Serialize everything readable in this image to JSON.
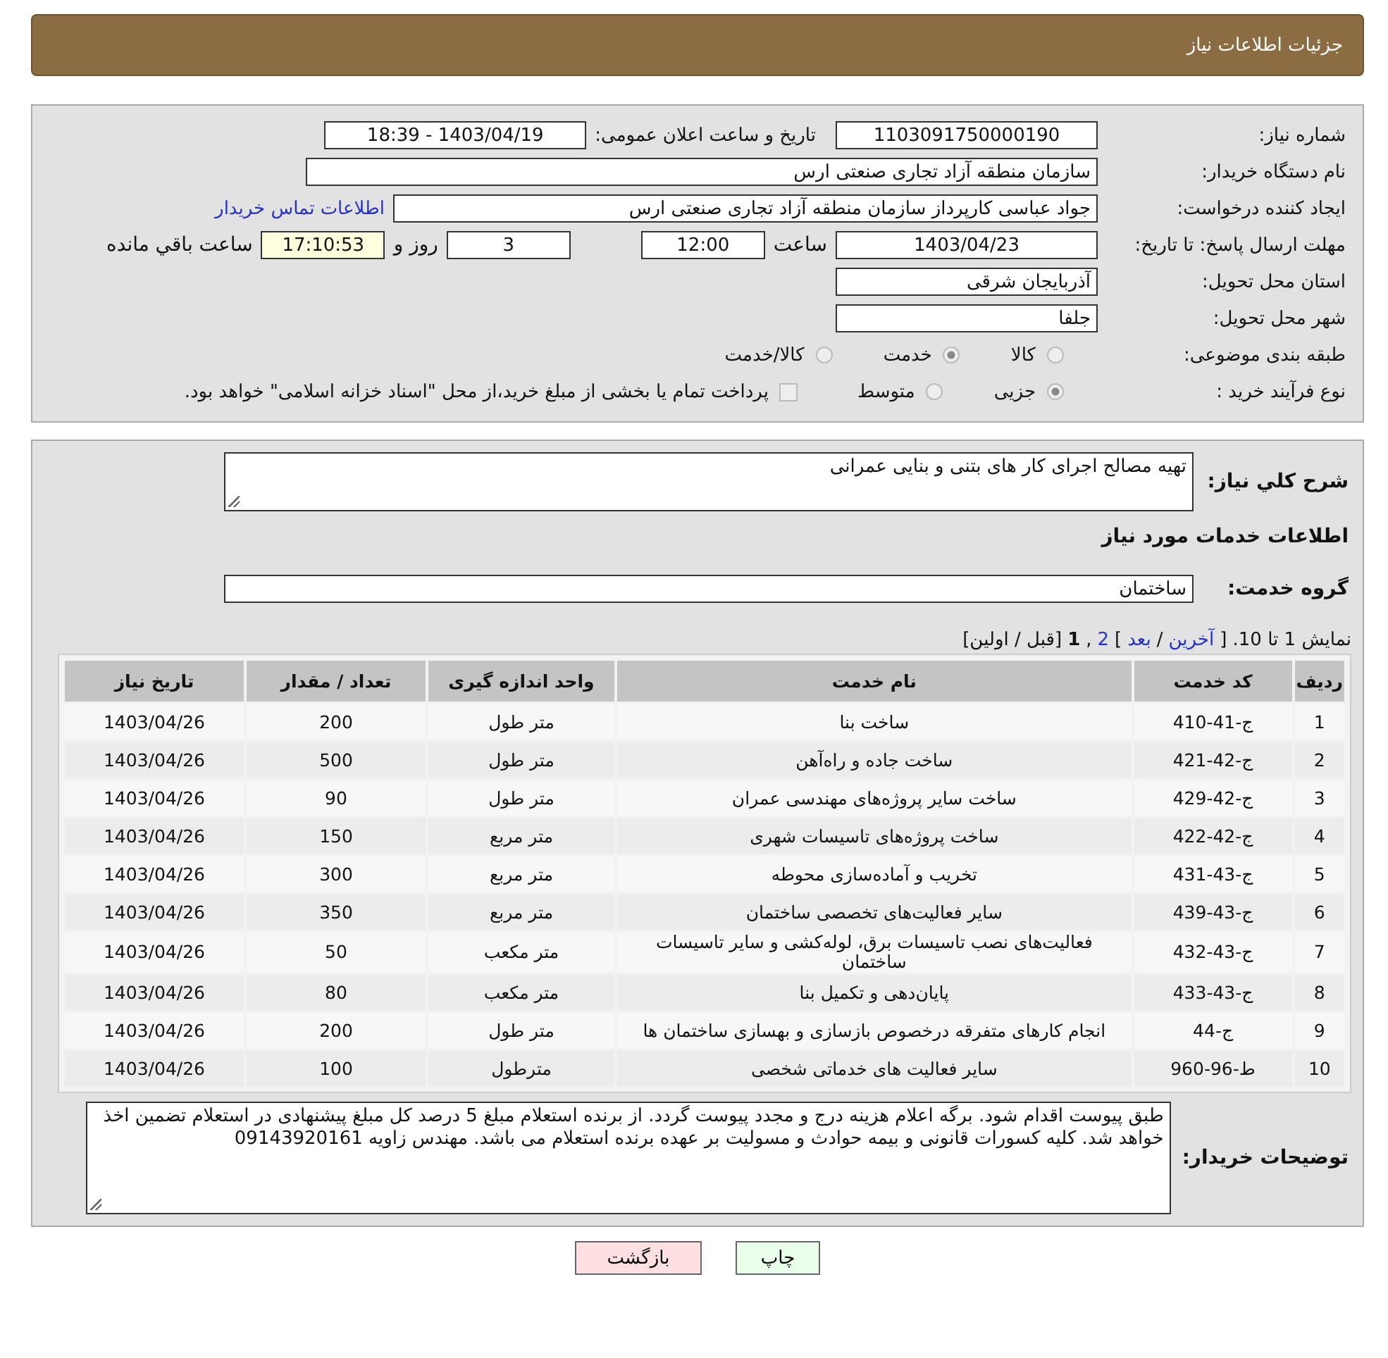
{
  "header": {
    "title": "جزئیات اطلاعات نیاز"
  },
  "info": {
    "need_number": {
      "label": "شماره نیاز:",
      "value": "1103091750000190"
    },
    "announce": {
      "label": "تاریخ و ساعت اعلان عمومی:",
      "value": "1403/04/19 - 18:39"
    },
    "buyer_org": {
      "label": "نام دستگاه خریدار:",
      "value": "سازمان منطقه آزاد تجاری صنعتی ارس"
    },
    "creator": {
      "label": "ایجاد کننده درخواست:",
      "value": "جواد عباسی کارپرداز سازمان منطقه آزاد تجاری صنعتی ارس",
      "link": "اطلاعات تماس خریدار"
    },
    "deadline": {
      "label": "مهلت ارسال پاسخ: تا تاریخ:",
      "date": "1403/04/23",
      "time_label": "ساعت",
      "time": "12:00",
      "days": "3",
      "days_label": "روز و",
      "remaining": "17:10:53",
      "remaining_label": "ساعت باقي مانده"
    },
    "province": {
      "label": "استان محل تحویل:",
      "value": "آذربایجان شرقی"
    },
    "city": {
      "label": "شهر محل تحویل:",
      "value": "جلفا"
    },
    "category": {
      "label": "طبقه بندی موضوعی:",
      "options": [
        {
          "label": "کالا",
          "selected": false
        },
        {
          "label": "خدمت",
          "selected": true
        },
        {
          "label": "کالا/خدمت",
          "selected": false
        }
      ]
    },
    "process": {
      "label": "نوع فرآیند خرید :",
      "options": [
        {
          "label": "جزیی",
          "selected": true
        },
        {
          "label": "متوسط",
          "selected": false
        }
      ],
      "treasury": {
        "checked": false,
        "label": "پرداخت تمام یا بخشی از مبلغ خرید،از محل \"اسناد خزانه اسلامی\" خواهد بود."
      }
    }
  },
  "details": {
    "summary": {
      "label": "شرح کلي نیاز:",
      "value": "تهیه مصالح  اجرای کار های بتنی و بنایی عمرانی"
    },
    "section_title": "اطلاعات خدمات مورد نیاز",
    "service_group": {
      "label": "گروه خدمت:",
      "value": "ساختمان"
    },
    "pagination": [
      {
        "kind": "text",
        "text": "نمایش 1 تا 10. ["
      },
      {
        "kind": "link",
        "text": "آخرین"
      },
      {
        "kind": "text",
        "text": "/"
      },
      {
        "kind": "link",
        "text": "بعد"
      },
      {
        "kind": "text",
        "text": "]"
      },
      {
        "kind": "link",
        "text": "2"
      },
      {
        "kind": "text",
        "text": ","
      },
      {
        "kind": "current",
        "text": "1"
      },
      {
        "kind": "text",
        "text": "[قبل / اولین]"
      }
    ],
    "table": {
      "columns": [
        "ردیف",
        "کد خدمت",
        "نام خدمت",
        "واحد اندازه گیری",
        "تعداد / مقدار",
        "تاریخ نیاز"
      ],
      "rows": [
        [
          "1",
          "ج-41-410",
          "ساخت بنا",
          "متر طول",
          "200",
          "1403/04/26"
        ],
        [
          "2",
          "ج-42-421",
          "ساخت جاده و راه‌آهن",
          "متر طول",
          "500",
          "1403/04/26"
        ],
        [
          "3",
          "ج-42-429",
          "ساخت سایر پروژه‌های مهندسی عمران",
          "متر طول",
          "90",
          "1403/04/26"
        ],
        [
          "4",
          "ج-42-422",
          "ساخت پروژه‌های تاسیسات شهری",
          "متر مربع",
          "150",
          "1403/04/26"
        ],
        [
          "5",
          "ج-43-431",
          "تخریب و آماده‌سازی محوطه",
          "متر مربع",
          "300",
          "1403/04/26"
        ],
        [
          "6",
          "ج-43-439",
          "سایر فعالیت‌های تخصصی ساختمان",
          "متر مربع",
          "350",
          "1403/04/26"
        ],
        [
          "7",
          "ج-43-432",
          "فعالیت‌های نصب تاسیسات برق، لوله‌کشی و سایر تاسیسات ساختمان",
          "متر مکعب",
          "50",
          "1403/04/26"
        ],
        [
          "8",
          "ج-43-433",
          "پایان‌دهی و تکمیل بنا",
          "متر مکعب",
          "80",
          "1403/04/26"
        ],
        [
          "9",
          "ج-44",
          "انجام کارهای متفرقه درخصوص بازسازی و بهسازی ساختمان ها",
          "متر طول",
          "200",
          "1403/04/26"
        ],
        [
          "10",
          "ط-96-960",
          "سایر فعالیت های خدماتی شخصی",
          "مترطول",
          "100",
          "1403/04/26"
        ]
      ]
    },
    "notes": {
      "label": "توضیحات خریدار:",
      "value": "طبق پیوست اقدام شود. برگه اعلام هزینه درج و مجدد پیوست گردد. از برنده استعلام مبلغ 5 درصد کل مبلغ پیشنهادی در استعلام تضمین اخذ خواهد شد. کلیه کسورات قانونی و بیمه حوادث و مسولیت بر عهده برنده استعلام می باشد. مهندس زاویه 09143920161"
    }
  },
  "buttons": [
    {
      "kind": "print",
      "label": "چاپ"
    },
    {
      "kind": "back",
      "label": "بازگشت"
    }
  ]
}
